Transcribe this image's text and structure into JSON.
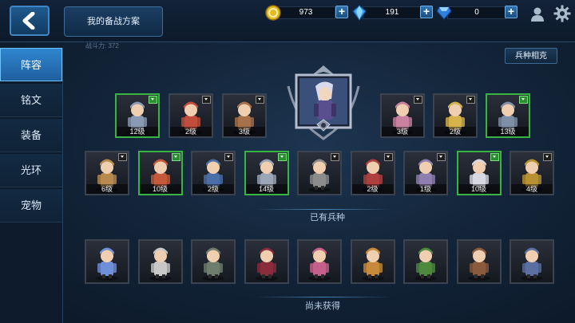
{
  "header": {
    "plan_button": "我的备战方案",
    "gold": "973",
    "crystal": "191",
    "diamond": "0"
  },
  "sidebar": {
    "items": [
      {
        "label": "阵容",
        "active": true
      },
      {
        "label": "铭文",
        "active": false
      },
      {
        "label": "装备",
        "active": false
      },
      {
        "label": "光环",
        "active": false
      },
      {
        "label": "宠物",
        "active": false
      }
    ]
  },
  "main": {
    "faded_label": "战斗力: 372",
    "counter_button": "兵种相克",
    "owned_label": "已有兵种",
    "unowned_label": "尚未获得"
  },
  "row1_left": [
    {
      "level": "12级",
      "green": true,
      "color": "#8a9ab5",
      "icon": "knight"
    },
    {
      "level": "2级",
      "green": false,
      "color": "#c24d3c",
      "icon": "swordsman"
    },
    {
      "level": "3级",
      "green": false,
      "color": "#a7714a",
      "icon": "monk"
    }
  ],
  "row1_right": [
    {
      "level": "3级",
      "green": false,
      "color": "#c8819e",
      "icon": "pink-brute"
    },
    {
      "level": "2级",
      "green": false,
      "color": "#d6b24a",
      "icon": "blonde-fighter"
    },
    {
      "level": "13级",
      "green": true,
      "color": "#7f8fa8",
      "icon": "dark-knight"
    }
  ],
  "row2": [
    {
      "level": "6级",
      "green": false,
      "color": "#b98a4e",
      "icon": "beast-warrior"
    },
    {
      "level": "10级",
      "green": true,
      "color": "#c45a3a",
      "icon": "barbarian"
    },
    {
      "level": "2级",
      "green": false,
      "color": "#4a6fa8",
      "icon": "blue-fighter"
    },
    {
      "level": "14级",
      "green": true,
      "color": "#9ca6b8",
      "icon": "cavalry"
    },
    {
      "level": "",
      "green": false,
      "color": "#8c8c8c",
      "icon": "armored-knight"
    },
    {
      "level": "2级",
      "green": false,
      "color": "#b04040",
      "icon": "red-swordsman"
    },
    {
      "level": "1级",
      "green": false,
      "color": "#8f7fb0",
      "icon": "hooded-rogue"
    },
    {
      "level": "10级",
      "green": true,
      "color": "#d8d8e0",
      "icon": "white-mage"
    },
    {
      "level": "4级",
      "green": false,
      "color": "#b89232",
      "icon": "horned-warrior"
    }
  ],
  "row3": [
    {
      "color": "#6f8fd8",
      "icon": "crystal-pet"
    },
    {
      "color": "#c8c8c8",
      "icon": "ghost-maiden"
    },
    {
      "color": "#6e7d6e",
      "icon": "zombie"
    },
    {
      "color": "#8a2c3c",
      "icon": "vampire"
    },
    {
      "color": "#c4608a",
      "icon": "pink-witch"
    },
    {
      "color": "#c78a3a",
      "icon": "dwarf"
    },
    {
      "color": "#4e8a3e",
      "icon": "elf-archer"
    },
    {
      "color": "#8a5a3c",
      "icon": "bear"
    },
    {
      "color": "#5b6fa0",
      "icon": "crossbowman"
    }
  ],
  "hero": {
    "color": "#a8a8d8",
    "icon": "hero-ninja"
  }
}
